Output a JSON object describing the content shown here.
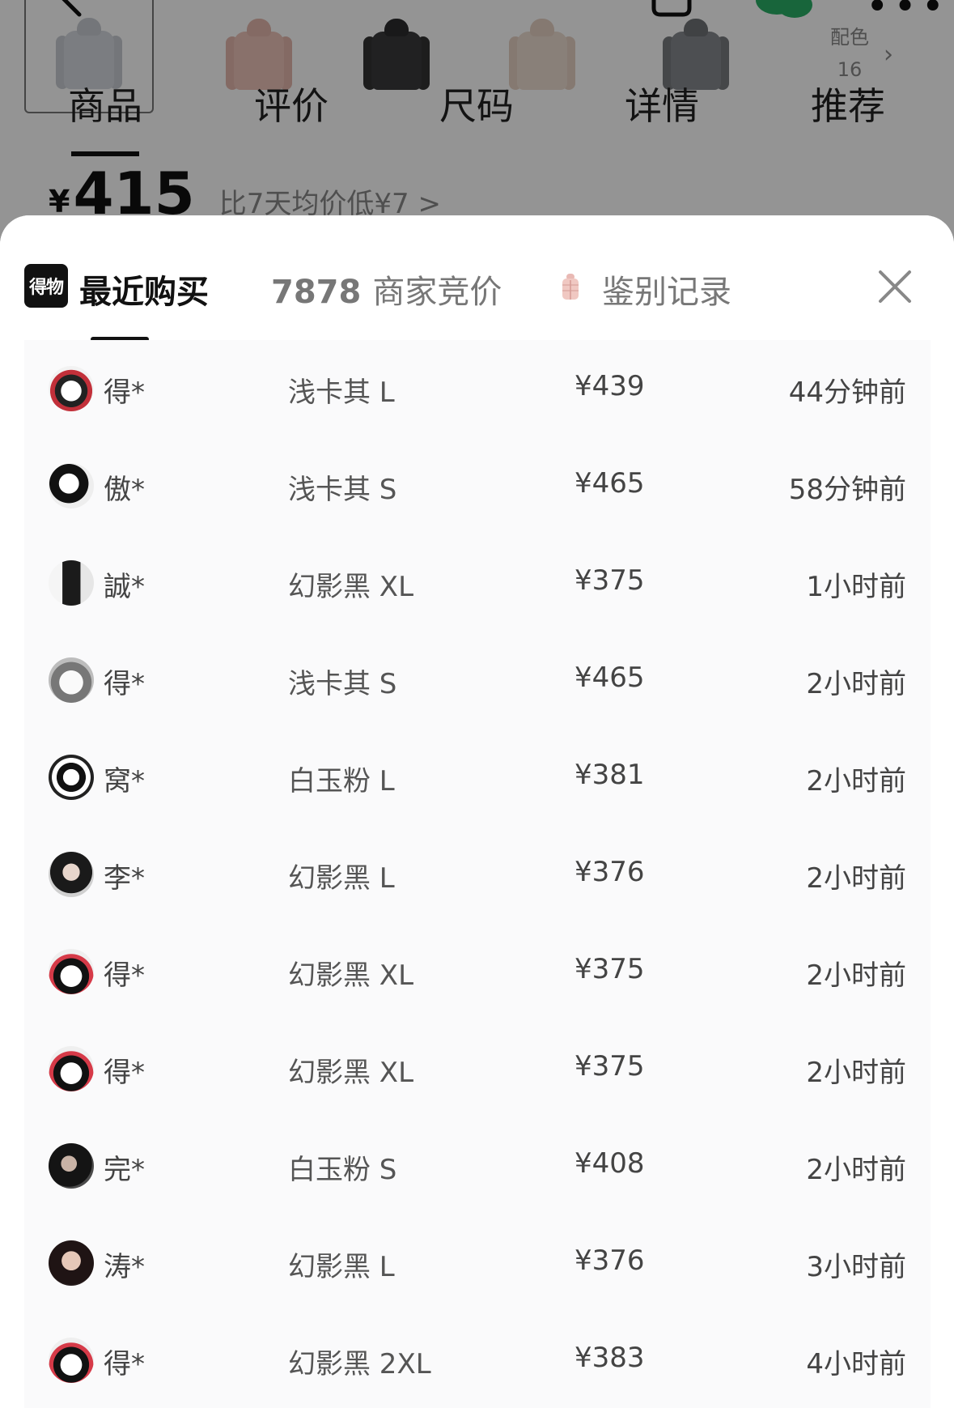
{
  "background_page": {
    "swatch_more_label": "配色",
    "swatch_more_count": "16",
    "nav_tabs": [
      "商品",
      "评价",
      "尺码",
      "详情",
      "推荐"
    ],
    "price_currency": "¥",
    "price_value": "415",
    "price_compare": "比7天均价低¥7 >"
  },
  "sheet": {
    "logo_text": "得物",
    "tab_recent": "最近购买",
    "tab_bids_count": "7878",
    "tab_bids_label": "商家竞价",
    "tab_auth": "鉴别记录",
    "records": [
      {
        "user": "得*",
        "spec": "浅卡其 L",
        "price": "¥439",
        "time": "44分钟前"
      },
      {
        "user": "傲*",
        "spec": "浅卡其 S",
        "price": "¥465",
        "time": "58分钟前"
      },
      {
        "user": "誠*",
        "spec": "幻影黑 XL",
        "price": "¥375",
        "time": "1小时前"
      },
      {
        "user": "得*",
        "spec": "浅卡其 S",
        "price": "¥465",
        "time": "2小时前"
      },
      {
        "user": "窝*",
        "spec": "白玉粉 L",
        "price": "¥381",
        "time": "2小时前"
      },
      {
        "user": "李*",
        "spec": "幻影黑 L",
        "price": "¥376",
        "time": "2小时前"
      },
      {
        "user": "得*",
        "spec": "幻影黑 XL",
        "price": "¥375",
        "time": "2小时前"
      },
      {
        "user": "得*",
        "spec": "幻影黑 XL",
        "price": "¥375",
        "time": "2小时前"
      },
      {
        "user": "完*",
        "spec": "白玉粉 S",
        "price": "¥408",
        "time": "2小时前"
      },
      {
        "user": "涛*",
        "spec": "幻影黑 L",
        "price": "¥376",
        "time": "3小时前"
      },
      {
        "user": "得*",
        "spec": "幻影黑 2XL",
        "price": "¥383",
        "time": "4小时前"
      }
    ]
  }
}
